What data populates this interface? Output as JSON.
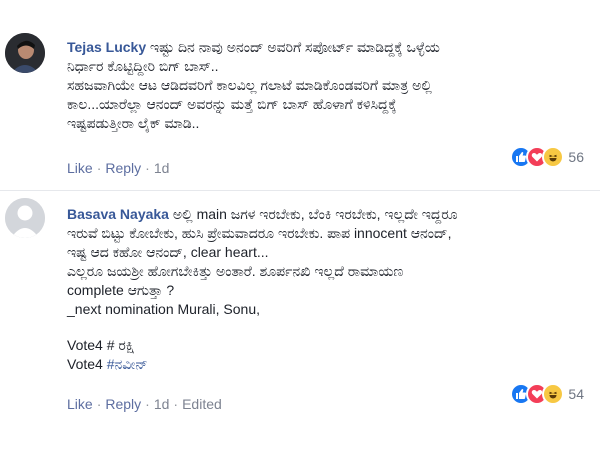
{
  "comments": [
    {
      "author": "Tejas Lucky",
      "lines": [
        "ಇಷ್ಟು ದಿನ ನಾವು ಅನಂದ್ ಅವರಿಗೆ ಸಪೋರ್ಟ್ ಮಾಡಿದ್ದಕ್ಕೆ ಒಳ್ಳೆಯ",
        "ನಿರ್ಧಾರ ಕೊಟ್ಟಿದ್ದೀರಿ ಬಿಗ್ ಬಾಸ್..",
        "ಸಹಜವಾಗಿಯೇ ಆಟ ಆಡಿದವರಿಗೆ ಕಾಲವಿಲ್ಲ ಗಲಾಟೆ ಮಾಡಿಕೊಂಡವರಿಗೆ ಮಾತ್ರ ಅಲ್ಲಿ",
        "ಕಾಲ...ಯಾರೆಲ್ಲಾ ಆನಂದ್ ಅವರನ್ನು ಮತ್ತೆ ಬಿಗ್ ಬಾಸ್ ಹೊಳಾಗೆ ಕಳಿಸಿದ್ದಕ್ಕೆ",
        "ಇಷ್ಟಪಡುತ್ತೀರಾ ಲೈಕ್ ಮಾಡಿ.."
      ],
      "actions": {
        "like": "Like",
        "reply": "Reply",
        "time": "1d"
      },
      "reactions": {
        "types": [
          "like-icon",
          "love-icon",
          "haha-icon"
        ],
        "count": "56"
      }
    },
    {
      "author": "Basava Nayaka",
      "lines": [
        "ಅಲ್ಲಿ main ಜಗಳ ಇರಬೇಕು, ಬೆಂಕಿ ಇರಬೇಕು, ಇಲ್ಲದೇ ಇದ್ದರೂ",
        "ಇರುವೆ ಬಿಟ್ಟು ಕೋಬೇಕು, ಹುಸಿ ಪ್ರೇಮವಾದರೂ ಇರಬೇಕು. ಪಾಪ innocent ಆನಂದ್,",
        "ಇಷ್ಟ ಆದ ಕಹೋ ಆನಂದ್, clear heart...",
        "ಎಲ್ಲರೂ ಜಯಶ್ರೀ ಹೋಗಬೇಕಿತ್ತು ಅಂತಾರೆ. ಶೂರ್ಪನಖಿ ಇಲ್ಲದೆ ರಾಮಾಯಣ",
        "complete ಆಗುತ್ತಾ ?",
        "_next nomination Murali, Sonu,"
      ],
      "votes": [
        {
          "prefix": "Vote4 # ",
          "value": "ರಕ್ಷಿ",
          "is_link": false
        },
        {
          "prefix": "Vote4 ",
          "value": "#ನವೀನ್",
          "is_link": true
        }
      ],
      "actions": {
        "like": "Like",
        "reply": "Reply",
        "time": "1d",
        "edited": "Edited"
      },
      "reactions": {
        "types": [
          "like-icon",
          "love-icon",
          "haha-icon"
        ],
        "count": "54"
      }
    }
  ],
  "colors": {
    "author": "#385898",
    "like": "#1877f2",
    "love": "#f33e58",
    "haha": "#f7c843"
  }
}
